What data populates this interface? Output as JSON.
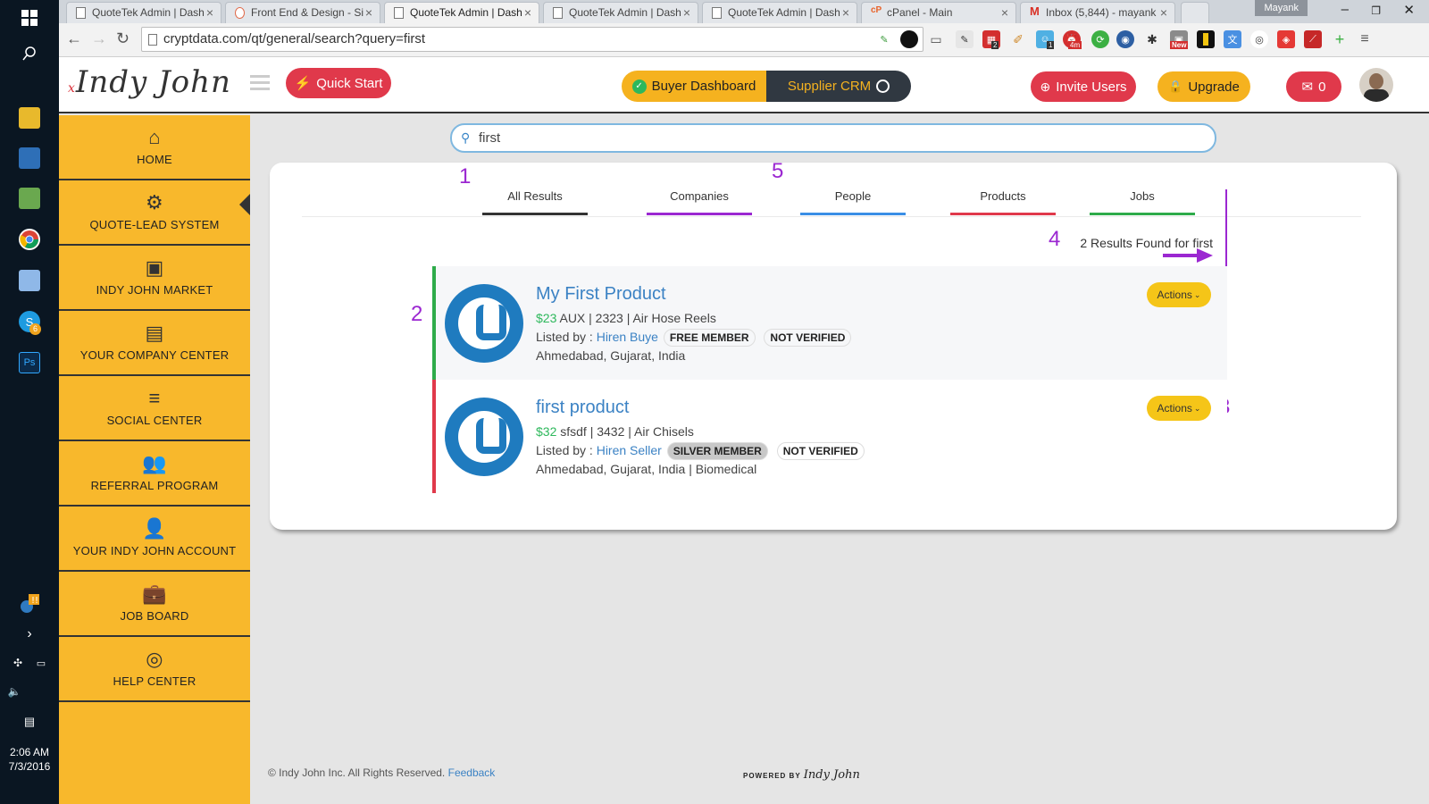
{
  "taskbar": {
    "time": "2:06 AM",
    "date": "7/3/2016",
    "skype_badge": "6",
    "ps_label": "Ps"
  },
  "browser": {
    "tabs": [
      {
        "title": "QuoteTek Admin | Dash"
      },
      {
        "title": "Front End & Design - Si"
      },
      {
        "title": "QuoteTek Admin | Dash"
      },
      {
        "title": "QuoteTek Admin | Dash"
      },
      {
        "title": "QuoteTek Admin | Dash"
      },
      {
        "title": "cPanel - Main"
      },
      {
        "title": "Inbox (5,844) - mayank"
      }
    ],
    "user": "Mayank",
    "url": "cryptdata.com/qt/general/search?query=first",
    "ext_badges": {
      "b1": "2",
      "b2": "1",
      "b3": "4m",
      "b4": "New"
    }
  },
  "header": {
    "logo_text": "Indy John",
    "logo_mark": "x",
    "quick_start": "Quick Start",
    "buyer_dashboard": "Buyer Dashboard",
    "supplier_crm": "Supplier CRM",
    "invite_users": "Invite Users",
    "upgrade": "Upgrade",
    "messages_count": "0"
  },
  "sidebar": {
    "items": [
      {
        "label": "HOME",
        "icon": "home-icon"
      },
      {
        "label": "QUOTE-LEAD SYSTEM",
        "icon": "gears-icon"
      },
      {
        "label": "INDY JOHN MARKET",
        "icon": "money-icon"
      },
      {
        "label": "YOUR COMPANY CENTER",
        "icon": "archive-icon"
      },
      {
        "label": "SOCIAL CENTER",
        "icon": "list-icon"
      },
      {
        "label": "REFERRAL PROGRAM",
        "icon": "users-icon"
      },
      {
        "label": "YOUR INDY JOHN ACCOUNT",
        "icon": "user-secret-icon"
      },
      {
        "label": "JOB BOARD",
        "icon": "briefcase-icon"
      },
      {
        "label": "HELP CENTER",
        "icon": "life-ring-icon"
      }
    ]
  },
  "search": {
    "value": "first"
  },
  "result_tabs": [
    {
      "label": "All Results",
      "color": "#333333"
    },
    {
      "label": "Companies",
      "color": "#9b27d1"
    },
    {
      "label": "People",
      "color": "#3a8ee6"
    },
    {
      "label": "Products",
      "color": "#e0394b"
    },
    {
      "label": "Jobs",
      "color": "#2eab4a"
    }
  ],
  "results_count": "2 Results Found for first",
  "annotations": {
    "n1": "1",
    "n2": "2",
    "n3": "3",
    "n4": "4",
    "n5": "5"
  },
  "results": [
    {
      "title": "My First Product",
      "price": "$23",
      "meta": " AUX | 2323 | Air Hose Reels",
      "listed_by_label": "Listed by : ",
      "seller": "Hiren Buye",
      "membership": "FREE MEMBER",
      "verified": "NOT VERIFIED",
      "location": "Ahmedabad, Gujarat, India",
      "actions": "Actions",
      "strip_color": "#2eab4a"
    },
    {
      "title": "first product",
      "price": "$32",
      "meta": " sfsdf | 3432 | Air Chisels",
      "listed_by_label": "Listed by : ",
      "seller": "Hiren Seller",
      "membership": "SILVER MEMBER",
      "verified": "NOT VERIFIED",
      "location": "Ahmedabad, Gujarat, India | Biomedical",
      "actions": "Actions",
      "strip_color": "#e0394b"
    }
  ],
  "footer": {
    "copyright": "© Indy John Inc. All Rights Reserved. ",
    "feedback": "Feedback",
    "powered_by": "POWERED BY",
    "powered_brand": "Indy John"
  }
}
